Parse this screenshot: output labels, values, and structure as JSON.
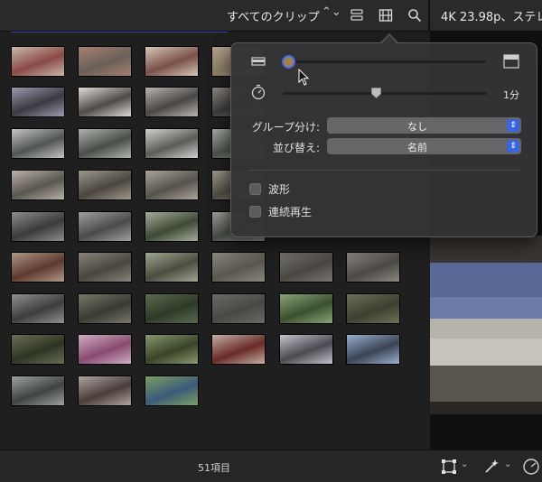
{
  "toolbar": {
    "clip_filter": "すべてのクリップ",
    "clip_filter_chevron": "⌃⌄",
    "viewer_title": "4K 23.98p、ステレ"
  },
  "popover": {
    "clip_duration_value": "1分",
    "group_by": {
      "label": "グループ分け:",
      "value": "なし"
    },
    "sort_by": {
      "label": "並び替え:",
      "value": "名前"
    },
    "waveforms": {
      "label": "波形",
      "checked": false
    },
    "continuous_playback": {
      "label": "連続再生",
      "checked": false
    }
  },
  "status": {
    "item_count": "51項目"
  },
  "colors": {
    "accent": "#3a64e0",
    "popover_bg": "#343436"
  },
  "thumbnails": [
    {
      "c1": "#8a4a46",
      "c2": "#c9b9a8"
    },
    {
      "c1": "#6a6058",
      "c2": "#a88070"
    },
    {
      "c1": "#7a5048",
      "c2": "#d6c8b8"
    },
    {
      "c1": "#8a7b60",
      "c2": "#b0a090"
    },
    {
      "c1": "#3a3a40",
      "c2": "#9a9ab0"
    },
    {
      "c1": "#504a46",
      "c2": "#e0dcd6"
    },
    {
      "c1": "#4a4644",
      "c2": "#b8b4ae"
    },
    {
      "c1": "#3c3a38",
      "c2": "#8a8680"
    },
    {
      "c1": "#505452",
      "c2": "#c4c6c4"
    },
    {
      "c1": "#4a4e48",
      "c2": "#b0b4ae"
    },
    {
      "c1": "#5a5c58",
      "c2": "#d0d2ce"
    },
    {
      "c1": "#4c504a",
      "c2": "#a4a8a2"
    },
    {
      "c1": "#5a5650",
      "c2": "#b8b2aa"
    },
    {
      "c1": "#4a463e",
      "c2": "#a09a8e"
    },
    {
      "c1": "#56524c",
      "c2": "#aaa49c"
    },
    {
      "c1": "#4e4a44",
      "c2": "#9c968c"
    },
    {
      "c1": "#3a3c3c",
      "c2": "#8c8e8e"
    },
    {
      "c1": "#4a4c4a",
      "c2": "#a0a2a0"
    },
    {
      "c1": "#3e4a36",
      "c2": "#a6ae9a"
    },
    {
      "c1": "#464a44",
      "c2": "#9a9e98"
    },
    {
      "c1": "#5c3a30",
      "c2": "#b09888"
    },
    {
      "c1": "#4a4640",
      "c2": "#8a8478"
    },
    {
      "c1": "#4a4e40",
      "c2": "#a0a692"
    },
    {
      "c1": "#5c5650",
      "c2": "#8a8680"
    },
    {
      "c1": "#4a4642",
      "c2": "#787470"
    },
    {
      "c1": "#4c4844",
      "c2": "#8c8884"
    },
    {
      "c1": "#3c3e3e",
      "c2": "#90928e"
    },
    {
      "c1": "#3a3a34",
      "c2": "#7a7868"
    },
    {
      "c1": "#2e3a28",
      "c2": "#5c6a50"
    },
    {
      "c1": "#4a4842",
      "c2": "#6c6a64"
    },
    {
      "c1": "#3c5030",
      "c2": "#8aa47a"
    },
    {
      "c1": "#3c4030",
      "c2": "#6c7258"
    },
    {
      "c1": "#2e3424",
      "c2": "#6a7054"
    },
    {
      "c1": "#8a4a70",
      "c2": "#d0b0c4"
    },
    {
      "c1": "#3a4428",
      "c2": "#8a9870"
    },
    {
      "c1": "#6a2a26",
      "c2": "#c4b0a8"
    },
    {
      "c1": "#4a4a50",
      "c2": "#c4c4cc"
    },
    {
      "c1": "#3a4454",
      "c2": "#9ab0d0"
    },
    {
      "c1": "#3e4440",
      "c2": "#9ca2a0"
    },
    {
      "c1": "#4a3e3a",
      "c2": "#b0a4a0"
    },
    {
      "c1": "#3c5a7a",
      "c2": "#7aa060"
    }
  ]
}
